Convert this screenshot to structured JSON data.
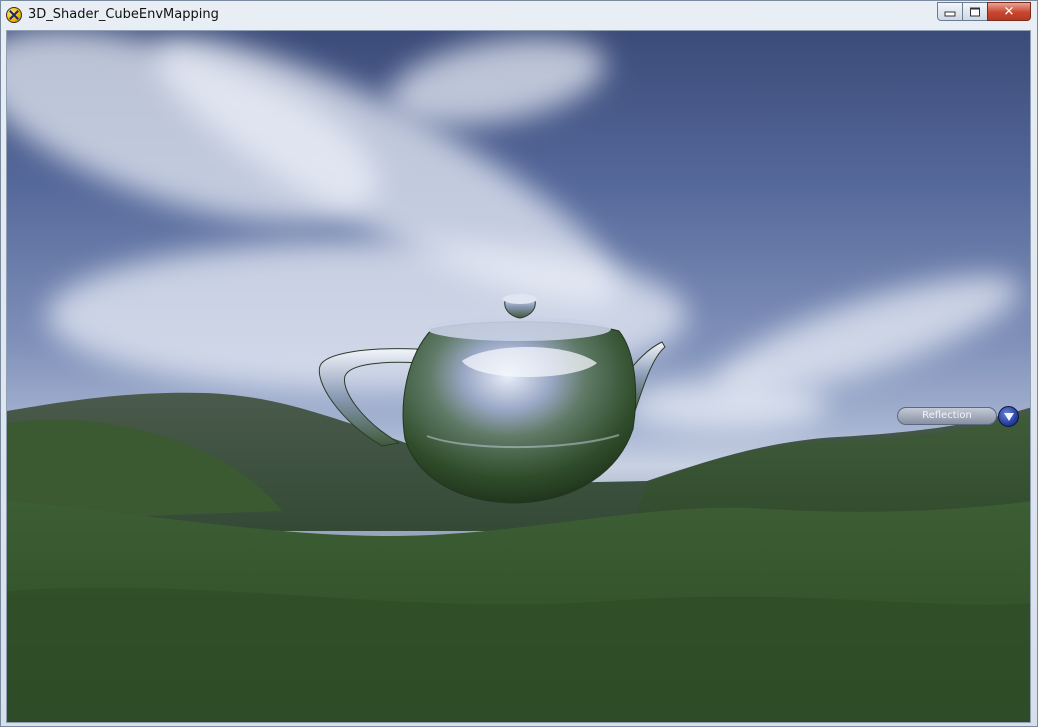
{
  "window": {
    "title": "3D_Shader_CubeEnvMapping",
    "controls": {
      "minimize": "minimize",
      "maximize": "maximize",
      "close": "close"
    }
  },
  "scene": {
    "description": "teapot",
    "colors": {
      "sky_top": "#3b4b79",
      "horizon": "#c9d2e3",
      "grass": "#3c5c31"
    }
  },
  "ui": {
    "mode_dropdown": {
      "selected": "Reflection"
    }
  }
}
